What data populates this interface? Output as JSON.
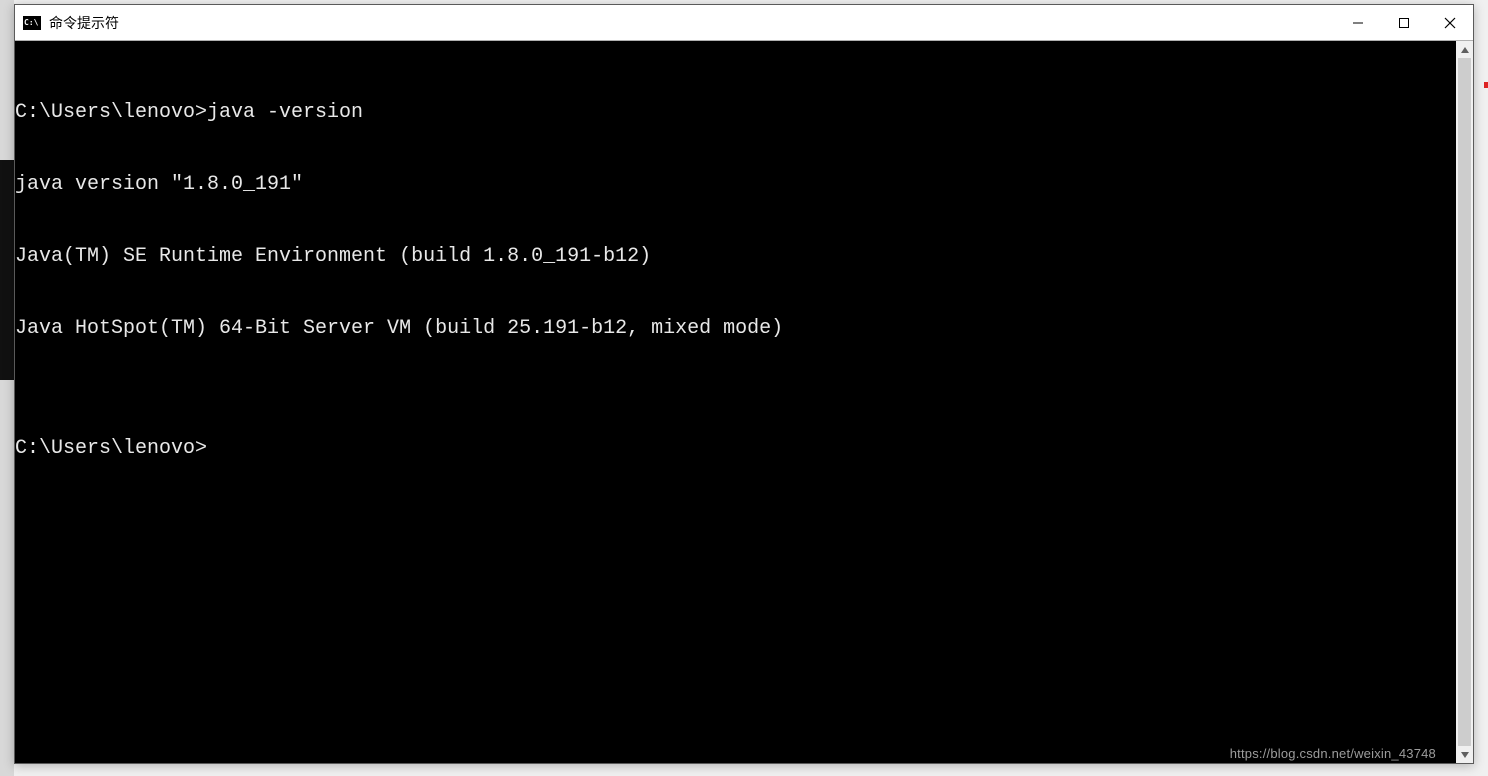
{
  "window": {
    "title": "命令提示符"
  },
  "terminal": {
    "lines": [
      "C:\\Users\\lenovo>java -version",
      "java version \"1.8.0_191\"",
      "Java(TM) SE Runtime Environment (build 1.8.0_191-b12)",
      "Java HotSpot(TM) 64-Bit Server VM (build 25.191-b12, mixed mode)",
      "",
      "C:\\Users\\lenovo>"
    ],
    "prompt_cwd": "C:\\Users\\lenovo",
    "last_command": "java -version"
  },
  "watermark": "https://blog.csdn.net/weixin_43748"
}
